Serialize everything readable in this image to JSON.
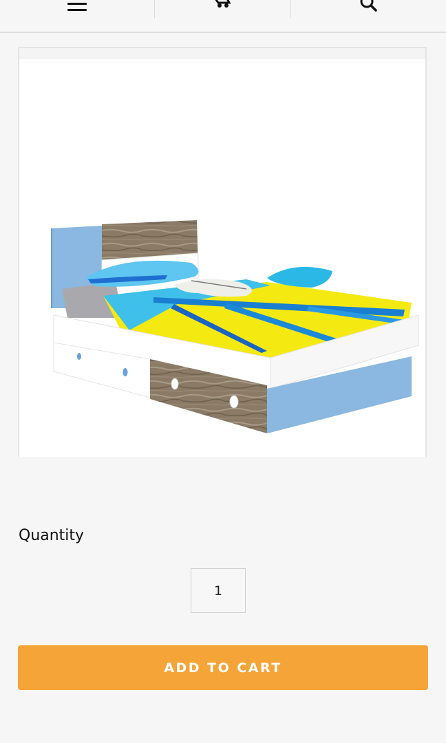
{
  "header": {
    "icons": [
      "hamburger-menu-icon",
      "shopping-cart-icon",
      "search-icon"
    ]
  },
  "product": {
    "image_icon": "bed-with-drawers-illustration"
  },
  "quantity": {
    "label": "Quantity",
    "value": "1"
  },
  "add_to_cart": {
    "label": "ADD TO CART"
  },
  "colors": {
    "accent": "#f5a437",
    "background": "#f6f6f6",
    "divider": "#dddddd"
  }
}
